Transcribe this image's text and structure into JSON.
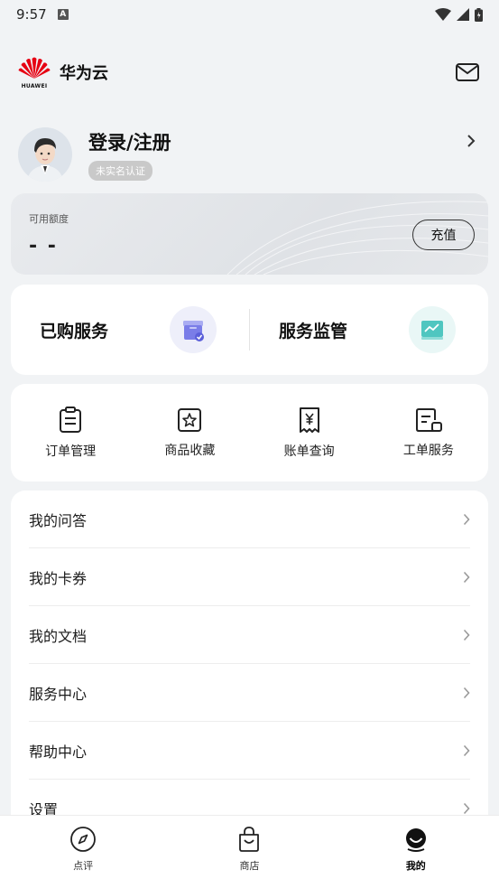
{
  "status_bar": {
    "time": "9:57",
    "a_label": "A"
  },
  "header": {
    "brand_word": "HUAWEI",
    "brand_name": "华为云"
  },
  "profile": {
    "login_label": "登录/注册",
    "verification_badge": "未实名认证"
  },
  "quota": {
    "label": "可用额度",
    "value": "- -",
    "recharge_label": "充值"
  },
  "services": {
    "purchased_label": "已购服务",
    "monitor_label": "服务监管"
  },
  "quick_actions": [
    {
      "label": "订单管理",
      "icon": "clipboard-icon"
    },
    {
      "label": "商品收藏",
      "icon": "star-icon"
    },
    {
      "label": "账单查询",
      "icon": "receipt-icon"
    },
    {
      "label": "工单服务",
      "icon": "ticket-icon"
    }
  ],
  "menu": [
    {
      "label": "我的问答"
    },
    {
      "label": "我的卡券"
    },
    {
      "label": "我的文档"
    },
    {
      "label": "服务中心"
    },
    {
      "label": "帮助中心"
    },
    {
      "label": "设置"
    }
  ],
  "tabbar": [
    {
      "label": "点评",
      "icon": "compass-icon",
      "active": false
    },
    {
      "label": "商店",
      "icon": "shopping-bag-icon",
      "active": false
    },
    {
      "label": "我的",
      "icon": "user-face-icon",
      "active": true
    }
  ],
  "colors": {
    "background": "#f1f3f5",
    "brand_red": "#e60012",
    "purchased_icon": "#7a7de8",
    "monitor_icon": "#4fc6c0"
  }
}
